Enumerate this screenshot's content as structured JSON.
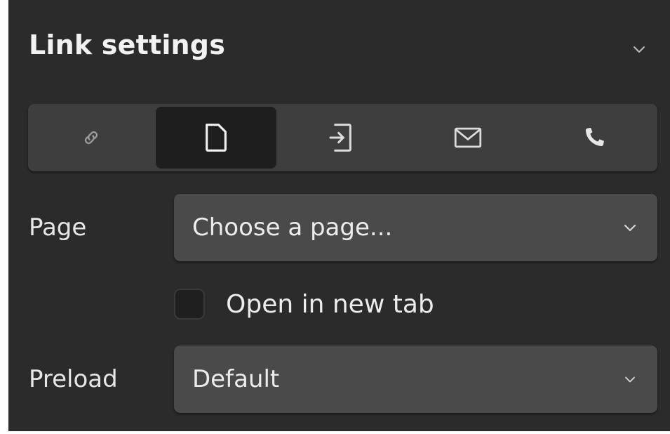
{
  "panel": {
    "title": "Link settings",
    "collapse_icon": "chevron-down-icon"
  },
  "link_types": [
    {
      "name": "url",
      "icon": "link-icon",
      "active": false
    },
    {
      "name": "page",
      "icon": "page-icon",
      "active": true
    },
    {
      "name": "page-section",
      "icon": "arrow-into-page-icon",
      "active": false
    },
    {
      "name": "email",
      "icon": "envelope-icon",
      "active": false
    },
    {
      "name": "phone",
      "icon": "phone-icon",
      "active": false
    }
  ],
  "page_field": {
    "label": "Page",
    "value": "Choose a page...",
    "icon": "chevron-down-icon"
  },
  "new_tab": {
    "label": "Open in new tab",
    "checked": false
  },
  "preload_field": {
    "label": "Preload",
    "value": "Default",
    "icon": "chevron-down-icon"
  },
  "colors": {
    "panel_bg": "#2b2b2b",
    "bar_bg": "#3e3e3e",
    "active_tab_bg": "#1e1e1e",
    "select_bg": "#4a4a4a",
    "text": "#ebebeb"
  }
}
